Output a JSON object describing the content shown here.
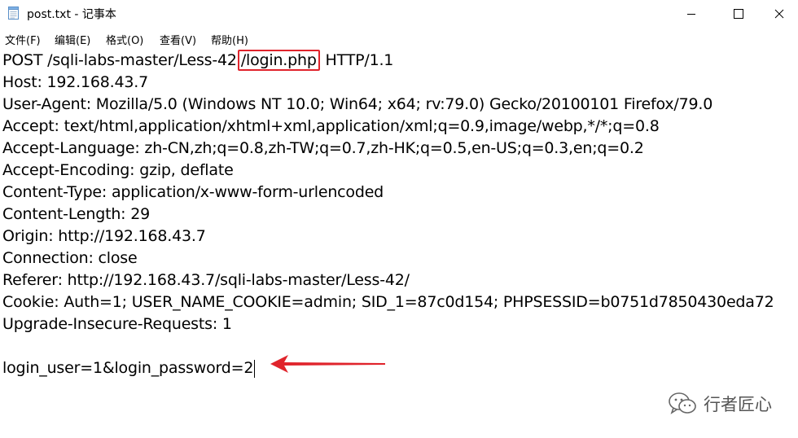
{
  "window": {
    "title": "post.txt - 记事本",
    "icon": "notepad-icon",
    "controls": [
      "minimize",
      "maximize",
      "close"
    ]
  },
  "menu": [
    {
      "label": "文件(F)"
    },
    {
      "label": "编辑(E)"
    },
    {
      "label": "格式(O)"
    },
    {
      "label": "查看(V)"
    },
    {
      "label": "帮助(H)"
    }
  ],
  "content": {
    "request_line": {
      "before": "POST /sqli-labs-master/Less-42",
      "highlight": "/login.php",
      "after": " HTTP/1.1"
    },
    "headers": [
      "Host: 192.168.43.7",
      "User-Agent: Mozilla/5.0 (Windows NT 10.0; Win64; x64; rv:79.0) Gecko/20100101 Firefox/79.0",
      "Accept: text/html,application/xhtml+xml,application/xml;q=0.9,image/webp,*/*;q=0.8",
      "Accept-Language: zh-CN,zh;q=0.8,zh-TW;q=0.7,zh-HK;q=0.5,en-US;q=0.3,en;q=0.2",
      "Accept-Encoding: gzip, deflate",
      "Content-Type: application/x-www-form-urlencoded",
      "Content-Length: 29",
      "Origin: http://192.168.43.7",
      "Connection: close",
      "Referer: http://192.168.43.7/sqli-labs-master/Less-42/",
      "Cookie: Auth=1; USER_NAME_COOKIE=admin; SID_1=87c0d154; PHPSESSID=b0751d7850430eda72",
      "Upgrade-Insecure-Requests: 1"
    ],
    "body": "login_user=1&login_password=2"
  },
  "annotations": {
    "highlight_color": "#e0242c",
    "arrow_color": "#e0242c"
  },
  "watermark": {
    "icon": "wechat-icon",
    "text": "行者匠心"
  }
}
